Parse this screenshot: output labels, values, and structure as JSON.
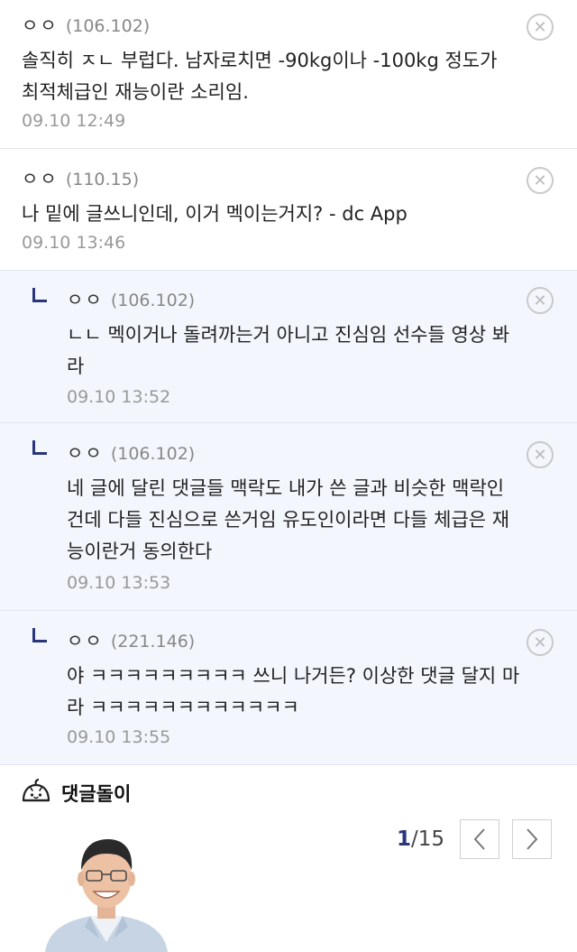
{
  "comments": [
    {
      "nick": "ㅇㅇ",
      "ip": "(106.102)",
      "text_lines": [
        "솔직히 ㅈㄴ 부럽다. 남자로치면 -90kg이나 -100kg 정도가",
        "최적체급인 재능이란 소리임."
      ],
      "date": "09.10 12:49"
    },
    {
      "nick": "ㅇㅇ",
      "ip": "(110.15)",
      "text_lines": [
        "나 밑에 글쓰니인데, 이거 멕이는거지? - dc App"
      ],
      "date": "09.10 13:46"
    },
    {
      "nick": "ㅇㅇ",
      "ip": "(106.102)",
      "text_lines": [
        "ㄴㄴ 멕이거나 돌려까는거 아니고 진심임 선수들 영상 봐",
        "라"
      ],
      "date": "09.10 13:52"
    },
    {
      "nick": "ㅇㅇ",
      "ip": "(106.102)",
      "text_lines": [
        "네 글에 달린 댓글들 맥락도 내가 쓴 글과 비슷한 맥락인",
        "건데 다들 진심으로 쓴거임 유도인이라면 다들 체급은 재",
        "능이란거 동의한다"
      ],
      "date": "09.10 13:53"
    },
    {
      "nick": "ㅇㅇ",
      "ip": "(221.146)",
      "text_lines": [
        "야 ㅋㅋㅋㅋㅋㅋㅋㅋㅋ 쓰니 나거든? 이상한 댓글 달지 마",
        "라 ㅋㅋㅋㅋㅋㅋㅋㅋㅋㅋㅋㅋ"
      ],
      "date": "09.10 13:55"
    }
  ],
  "delete_symbol": "✕",
  "comment_bot": {
    "title": "댓글돌이",
    "icon": "dumpling-mascot-icon"
  },
  "pager": {
    "current": "1",
    "total": "/15"
  },
  "colors": {
    "accent": "#29367c",
    "reply_bg": "#f3f6fc",
    "divider": "#e3e6ee"
  }
}
